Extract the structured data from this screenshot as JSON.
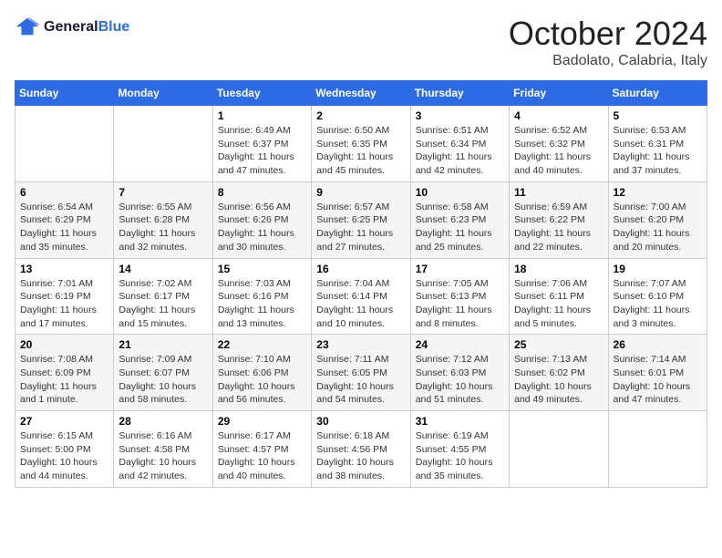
{
  "header": {
    "logo_line1": "General",
    "logo_line2": "Blue",
    "month": "October 2024",
    "location": "Badolato, Calabria, Italy"
  },
  "days_of_week": [
    "Sunday",
    "Monday",
    "Tuesday",
    "Wednesday",
    "Thursday",
    "Friday",
    "Saturday"
  ],
  "weeks": [
    [
      {
        "day": "",
        "info": ""
      },
      {
        "day": "",
        "info": ""
      },
      {
        "day": "1",
        "info": "Sunrise: 6:49 AM\nSunset: 6:37 PM\nDaylight: 11 hours and 47 minutes."
      },
      {
        "day": "2",
        "info": "Sunrise: 6:50 AM\nSunset: 6:35 PM\nDaylight: 11 hours and 45 minutes."
      },
      {
        "day": "3",
        "info": "Sunrise: 6:51 AM\nSunset: 6:34 PM\nDaylight: 11 hours and 42 minutes."
      },
      {
        "day": "4",
        "info": "Sunrise: 6:52 AM\nSunset: 6:32 PM\nDaylight: 11 hours and 40 minutes."
      },
      {
        "day": "5",
        "info": "Sunrise: 6:53 AM\nSunset: 6:31 PM\nDaylight: 11 hours and 37 minutes."
      }
    ],
    [
      {
        "day": "6",
        "info": "Sunrise: 6:54 AM\nSunset: 6:29 PM\nDaylight: 11 hours and 35 minutes."
      },
      {
        "day": "7",
        "info": "Sunrise: 6:55 AM\nSunset: 6:28 PM\nDaylight: 11 hours and 32 minutes."
      },
      {
        "day": "8",
        "info": "Sunrise: 6:56 AM\nSunset: 6:26 PM\nDaylight: 11 hours and 30 minutes."
      },
      {
        "day": "9",
        "info": "Sunrise: 6:57 AM\nSunset: 6:25 PM\nDaylight: 11 hours and 27 minutes."
      },
      {
        "day": "10",
        "info": "Sunrise: 6:58 AM\nSunset: 6:23 PM\nDaylight: 11 hours and 25 minutes."
      },
      {
        "day": "11",
        "info": "Sunrise: 6:59 AM\nSunset: 6:22 PM\nDaylight: 11 hours and 22 minutes."
      },
      {
        "day": "12",
        "info": "Sunrise: 7:00 AM\nSunset: 6:20 PM\nDaylight: 11 hours and 20 minutes."
      }
    ],
    [
      {
        "day": "13",
        "info": "Sunrise: 7:01 AM\nSunset: 6:19 PM\nDaylight: 11 hours and 17 minutes."
      },
      {
        "day": "14",
        "info": "Sunrise: 7:02 AM\nSunset: 6:17 PM\nDaylight: 11 hours and 15 minutes."
      },
      {
        "day": "15",
        "info": "Sunrise: 7:03 AM\nSunset: 6:16 PM\nDaylight: 11 hours and 13 minutes."
      },
      {
        "day": "16",
        "info": "Sunrise: 7:04 AM\nSunset: 6:14 PM\nDaylight: 11 hours and 10 minutes."
      },
      {
        "day": "17",
        "info": "Sunrise: 7:05 AM\nSunset: 6:13 PM\nDaylight: 11 hours and 8 minutes."
      },
      {
        "day": "18",
        "info": "Sunrise: 7:06 AM\nSunset: 6:11 PM\nDaylight: 11 hours and 5 minutes."
      },
      {
        "day": "19",
        "info": "Sunrise: 7:07 AM\nSunset: 6:10 PM\nDaylight: 11 hours and 3 minutes."
      }
    ],
    [
      {
        "day": "20",
        "info": "Sunrise: 7:08 AM\nSunset: 6:09 PM\nDaylight: 11 hours and 1 minute."
      },
      {
        "day": "21",
        "info": "Sunrise: 7:09 AM\nSunset: 6:07 PM\nDaylight: 10 hours and 58 minutes."
      },
      {
        "day": "22",
        "info": "Sunrise: 7:10 AM\nSunset: 6:06 PM\nDaylight: 10 hours and 56 minutes."
      },
      {
        "day": "23",
        "info": "Sunrise: 7:11 AM\nSunset: 6:05 PM\nDaylight: 10 hours and 54 minutes."
      },
      {
        "day": "24",
        "info": "Sunrise: 7:12 AM\nSunset: 6:03 PM\nDaylight: 10 hours and 51 minutes."
      },
      {
        "day": "25",
        "info": "Sunrise: 7:13 AM\nSunset: 6:02 PM\nDaylight: 10 hours and 49 minutes."
      },
      {
        "day": "26",
        "info": "Sunrise: 7:14 AM\nSunset: 6:01 PM\nDaylight: 10 hours and 47 minutes."
      }
    ],
    [
      {
        "day": "27",
        "info": "Sunrise: 6:15 AM\nSunset: 5:00 PM\nDaylight: 10 hours and 44 minutes."
      },
      {
        "day": "28",
        "info": "Sunrise: 6:16 AM\nSunset: 4:58 PM\nDaylight: 10 hours and 42 minutes."
      },
      {
        "day": "29",
        "info": "Sunrise: 6:17 AM\nSunset: 4:57 PM\nDaylight: 10 hours and 40 minutes."
      },
      {
        "day": "30",
        "info": "Sunrise: 6:18 AM\nSunset: 4:56 PM\nDaylight: 10 hours and 38 minutes."
      },
      {
        "day": "31",
        "info": "Sunrise: 6:19 AM\nSunset: 4:55 PM\nDaylight: 10 hours and 35 minutes."
      },
      {
        "day": "",
        "info": ""
      },
      {
        "day": "",
        "info": ""
      }
    ]
  ]
}
